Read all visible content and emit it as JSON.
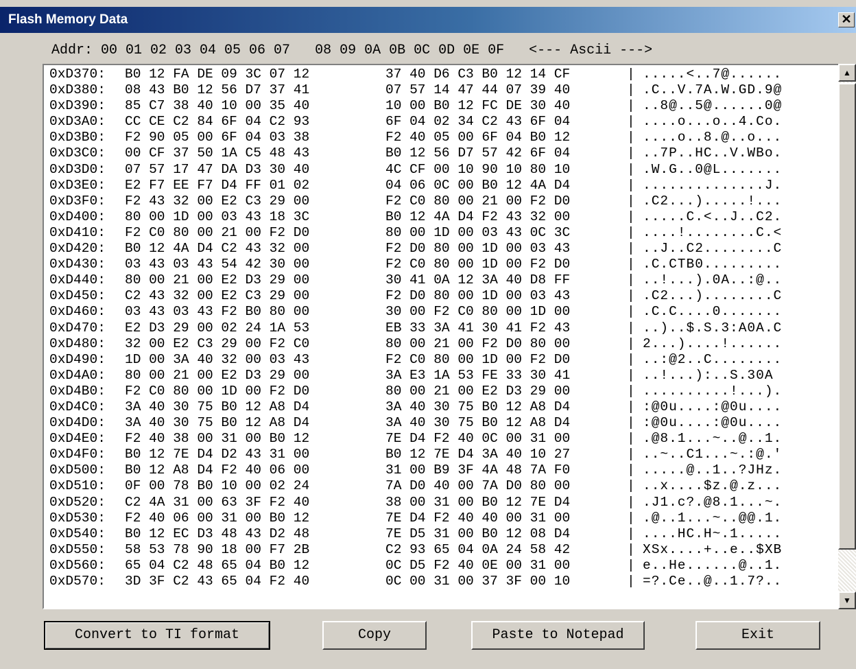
{
  "window": {
    "title": "Flash Memory Data",
    "close_glyph": "✕"
  },
  "header": {
    "text": "Addr: 00 01 02 03 04 05 06 07   08 09 0A 0B 0C 0D 0E 0F   <--- Ascii --->"
  },
  "rows": [
    {
      "addr": "0xD370:",
      "h1": "B0 12 FA DE 09 3C 07 12",
      "h2": "37 40 D6 C3 B0 12 14 CF",
      "ascii": ".....<..7@......"
    },
    {
      "addr": "0xD380:",
      "h1": "08 43 B0 12 56 D7 37 41",
      "h2": "07 57 14 47 44 07 39 40",
      "ascii": ".C..V.7A.W.GD.9@"
    },
    {
      "addr": "0xD390:",
      "h1": "85 C7 38 40 10 00 35 40",
      "h2": "10 00 B0 12 FC DE 30 40",
      "ascii": "..8@..5@......0@"
    },
    {
      "addr": "0xD3A0:",
      "h1": "CC CE C2 84 6F 04 C2 93",
      "h2": "6F 04 02 34 C2 43 6F 04",
      "ascii": "....o...o..4.Co."
    },
    {
      "addr": "0xD3B0:",
      "h1": "F2 90 05 00 6F 04 03 38",
      "h2": "F2 40 05 00 6F 04 B0 12",
      "ascii": "....o..8.@..o..."
    },
    {
      "addr": "0xD3C0:",
      "h1": "00 CF 37 50 1A C5 48 43",
      "h2": "B0 12 56 D7 57 42 6F 04",
      "ascii": "..7P..HC..V.WBo."
    },
    {
      "addr": "0xD3D0:",
      "h1": "07 57 17 47 DA D3 30 40",
      "h2": "4C CF 00 10 90 10 80 10",
      "ascii": ".W.G..0@L......."
    },
    {
      "addr": "0xD3E0:",
      "h1": "E2 F7 EE F7 D4 FF 01 02",
      "h2": "04 06 0C 00 B0 12 4A D4",
      "ascii": "..............J."
    },
    {
      "addr": "0xD3F0:",
      "h1": "F2 43 32 00 E2 C3 29 00",
      "h2": "F2 C0 80 00 21 00 F2 D0",
      "ascii": ".C2...).....!..."
    },
    {
      "addr": "0xD400:",
      "h1": "80 00 1D 00 03 43 18 3C",
      "h2": "B0 12 4A D4 F2 43 32 00",
      "ascii": ".....C.<..J..C2."
    },
    {
      "addr": "0xD410:",
      "h1": "F2 C0 80 00 21 00 F2 D0",
      "h2": "80 00 1D 00 03 43 0C 3C",
      "ascii": "....!........C.<"
    },
    {
      "addr": "0xD420:",
      "h1": "B0 12 4A D4 C2 43 32 00",
      "h2": "F2 D0 80 00 1D 00 03 43",
      "ascii": "..J..C2........C"
    },
    {
      "addr": "0xD430:",
      "h1": "03 43 03 43 54 42 30 00",
      "h2": "F2 C0 80 00 1D 00 F2 D0",
      "ascii": ".C.CTB0........."
    },
    {
      "addr": "0xD440:",
      "h1": "80 00 21 00 E2 D3 29 00",
      "h2": "30 41 0A 12 3A 40 D8 FF",
      "ascii": "..!...).0A..:@.."
    },
    {
      "addr": "0xD450:",
      "h1": "C2 43 32 00 E2 C3 29 00",
      "h2": "F2 D0 80 00 1D 00 03 43",
      "ascii": ".C2...)........C"
    },
    {
      "addr": "0xD460:",
      "h1": "03 43 03 43 F2 B0 80 00",
      "h2": "30 00 F2 C0 80 00 1D 00",
      "ascii": ".C.C....0......."
    },
    {
      "addr": "0xD470:",
      "h1": "E2 D3 29 00 02 24 1A 53",
      "h2": "EB 33 3A 41 30 41 F2 43",
      "ascii": "..)..$.S.3:A0A.C"
    },
    {
      "addr": "0xD480:",
      "h1": "32 00 E2 C3 29 00 F2 C0",
      "h2": "80 00 21 00 F2 D0 80 00",
      "ascii": "2...)....!......"
    },
    {
      "addr": "0xD490:",
      "h1": "1D 00 3A 40 32 00 03 43",
      "h2": "F2 C0 80 00 1D 00 F2 D0",
      "ascii": "..:@2..C........"
    },
    {
      "addr": "0xD4A0:",
      "h1": "80 00 21 00 E2 D3 29 00",
      "h2": "3A E3 1A 53 FE 33 30 41",
      "ascii": "..!...):..S.30A"
    },
    {
      "addr": "0xD4B0:",
      "h1": "F2 C0 80 00 1D 00 F2 D0",
      "h2": "80 00 21 00 E2 D3 29 00",
      "ascii": "..........!...)."
    },
    {
      "addr": "0xD4C0:",
      "h1": "3A 40 30 75 B0 12 A8 D4",
      "h2": "3A 40 30 75 B0 12 A8 D4",
      "ascii": ":@0u....:@0u...."
    },
    {
      "addr": "0xD4D0:",
      "h1": "3A 40 30 75 B0 12 A8 D4",
      "h2": "3A 40 30 75 B0 12 A8 D4",
      "ascii": ":@0u....:@0u...."
    },
    {
      "addr": "0xD4E0:",
      "h1": "F2 40 38 00 31 00 B0 12",
      "h2": "7E D4 F2 40 0C 00 31 00",
      "ascii": ".@8.1...~..@..1."
    },
    {
      "addr": "0xD4F0:",
      "h1": "B0 12 7E D4 D2 43 31 00",
      "h2": "B0 12 7E D4 3A 40 10 27",
      "ascii": "..~..C1...~.:@.'"
    },
    {
      "addr": "0xD500:",
      "h1": "B0 12 A8 D4 F2 40 06 00",
      "h2": "31 00 B9 3F 4A 48 7A F0",
      "ascii": ".....@..1..?JHz."
    },
    {
      "addr": "0xD510:",
      "h1": "0F 00 78 B0 10 00 02 24",
      "h2": "7A D0 40 00 7A D0 80 00",
      "ascii": "..x....$z.@.z..."
    },
    {
      "addr": "0xD520:",
      "h1": "C2 4A 31 00 63 3F F2 40",
      "h2": "38 00 31 00 B0 12 7E D4",
      "ascii": ".J1.c?.@8.1...~."
    },
    {
      "addr": "0xD530:",
      "h1": "F2 40 06 00 31 00 B0 12",
      "h2": "7E D4 F2 40 40 00 31 00",
      "ascii": ".@..1...~..@@.1."
    },
    {
      "addr": "0xD540:",
      "h1": "B0 12 EC D3 48 43 D2 48",
      "h2": "7E D5 31 00 B0 12 08 D4",
      "ascii": "....HC.H~.1....."
    },
    {
      "addr": "0xD550:",
      "h1": "58 53 78 90 18 00 F7 2B",
      "h2": "C2 93 65 04 0A 24 58 42",
      "ascii": "XSx....+..e..$XB"
    },
    {
      "addr": "0xD560:",
      "h1": "65 04 C2 48 65 04 B0 12",
      "h2": "0C D5 F2 40 0E 00 31 00",
      "ascii": "e..He......@..1."
    },
    {
      "addr": "0xD570:",
      "h1": "3D 3F C2 43 65 04 F2 40",
      "h2": "0C 00 31 00 37 3F 00 10",
      "ascii": "=?.Ce..@..1.7?.."
    }
  ],
  "separator": "|",
  "scrollbar": {
    "up_glyph": "▲",
    "down_glyph": "▼"
  },
  "buttons": {
    "convert": "Convert to TI format",
    "copy": "Copy",
    "paste": "Paste to Notepad",
    "exit": "Exit"
  }
}
